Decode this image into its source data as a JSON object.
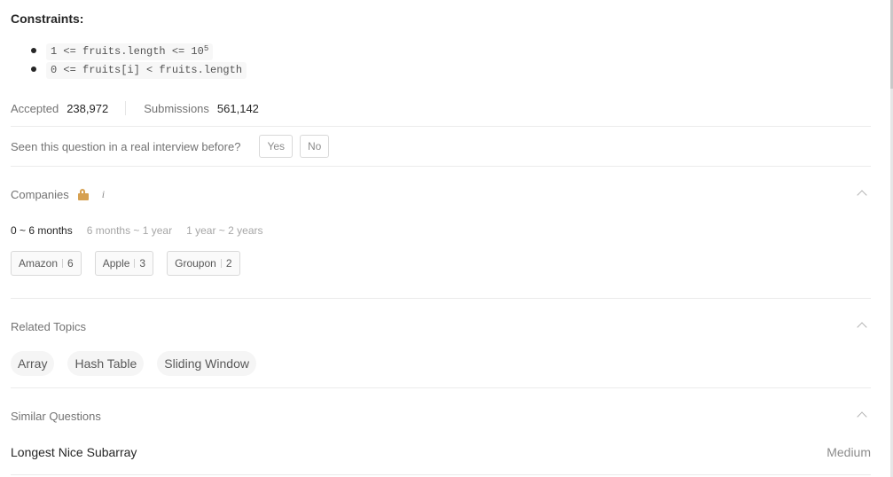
{
  "constraints": {
    "title": "Constraints:",
    "items": [
      {
        "text": "1 <= fruits.length <= 10",
        "sup": "5"
      },
      {
        "text": "0 <= fruits[i] < fruits.length",
        "sup": ""
      }
    ]
  },
  "stats": {
    "accepted_label": "Accepted",
    "accepted_value": "238,972",
    "submissions_label": "Submissions",
    "submissions_value": "561,142"
  },
  "seen": {
    "question": "Seen this question in a real interview before?",
    "yes_label": "Yes",
    "no_label": "No"
  },
  "companies": {
    "title": "Companies",
    "info_glyph": "i",
    "periods": [
      "0 ~ 6 months",
      "6 months ~ 1 year",
      "1 year ~ 2 years"
    ],
    "active_period": "0 ~ 6 months",
    "tags": [
      {
        "name": "Amazon",
        "count": "6"
      },
      {
        "name": "Apple",
        "count": "3"
      },
      {
        "name": "Groupon",
        "count": "2"
      }
    ]
  },
  "related_topics": {
    "title": "Related Topics",
    "tags": [
      "Array",
      "Hash Table",
      "Sliding Window"
    ]
  },
  "similar_questions": {
    "title": "Similar Questions",
    "items": [
      {
        "title": "Longest Nice Subarray",
        "difficulty": "Medium"
      }
    ]
  },
  "icons": {
    "lock": "lock-icon",
    "info": "info-icon",
    "chevron": "chevron-up-icon"
  },
  "colors": {
    "lock": "#d6a050",
    "text": "#262626",
    "muted": "#737373"
  }
}
